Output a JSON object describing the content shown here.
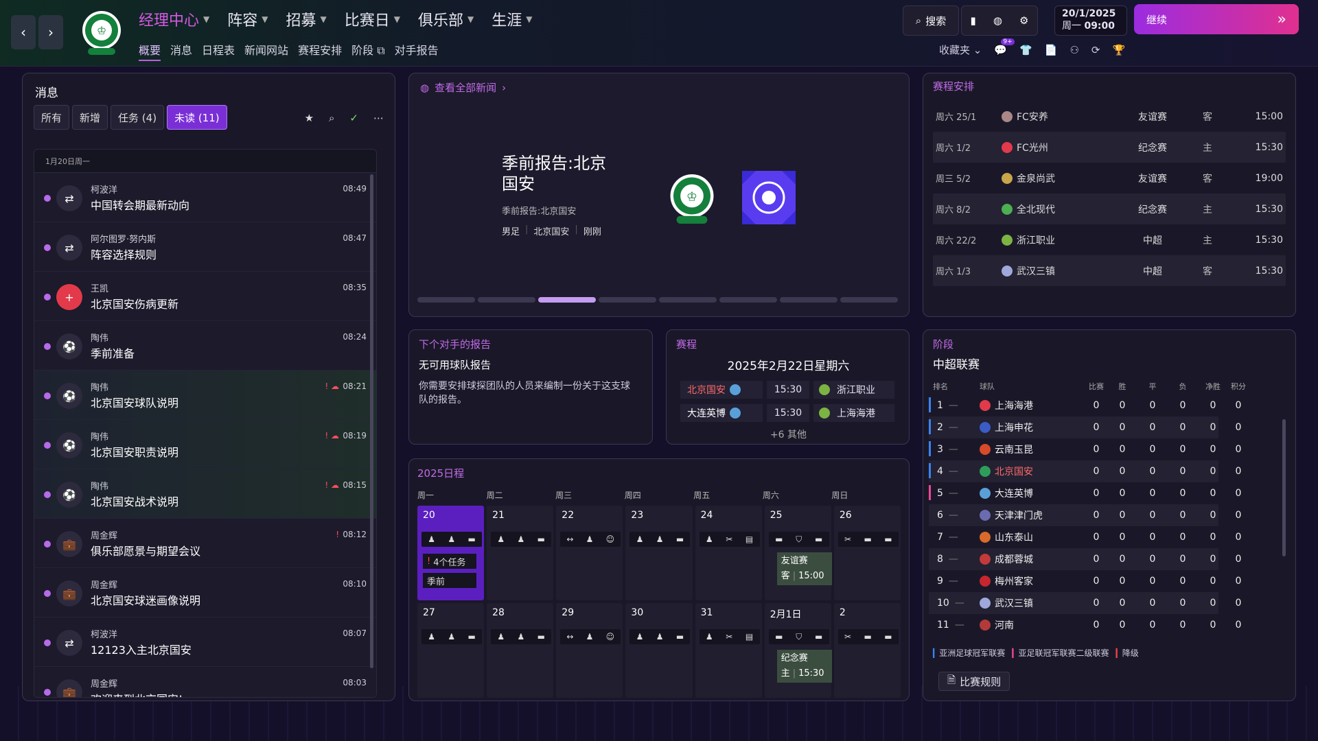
{
  "colors": {
    "accent": "#c25ae6",
    "continue_from": "#9b2ce0",
    "continue_to": "#e0308f",
    "champion_bar": "#3b82f6",
    "acl2_bar": "#ec4899",
    "relegation_bar": "#ef4444"
  },
  "nav": {
    "main": [
      {
        "label": "经理中心",
        "active": true
      },
      {
        "label": "阵容"
      },
      {
        "label": "招募"
      },
      {
        "label": "比赛日"
      },
      {
        "label": "俱乐部"
      },
      {
        "label": "生涯"
      }
    ],
    "sub": [
      "概要",
      "消息",
      "日程表",
      "新闻网站",
      "赛程安排",
      "阶段",
      "对手报告"
    ],
    "search": "搜索",
    "date": "20/1/2025",
    "weekday": "周一",
    "time": "09:00",
    "continue": "继续",
    "favorites": "收藏夹",
    "badge": "9+"
  },
  "messages": {
    "title": "消息",
    "tabs": [
      "所有",
      "新增",
      "任务 (4)",
      "未读 (11)"
    ],
    "date_header": "1月20日周一",
    "items": [
      {
        "from": "柯波洋",
        "subject": "中国转会期最新动向",
        "time": "08:49",
        "icon": "transfer-icon",
        "green": false,
        "flag": false
      },
      {
        "from": "阿尔图罗·努内斯",
        "subject": "阵容选择规则",
        "time": "08:47",
        "icon": "transfer-icon",
        "green": false,
        "flag": false
      },
      {
        "from": "王凯",
        "subject": "北京国安伤病更新",
        "time": "08:35",
        "icon": "medical-icon",
        "green": false,
        "flag": false
      },
      {
        "from": "陶伟",
        "subject": "季前准备",
        "time": "08:24",
        "icon": "team-icon",
        "green": false,
        "flag": false
      },
      {
        "from": "陶伟",
        "subject": "北京国安球队说明",
        "time": "08:21",
        "icon": "team-icon",
        "green": true,
        "flag": true
      },
      {
        "from": "陶伟",
        "subject": "北京国安职责说明",
        "time": "08:19",
        "icon": "team-icon",
        "green": true,
        "flag": true
      },
      {
        "from": "陶伟",
        "subject": "北京国安战术说明",
        "time": "08:15",
        "icon": "team-icon",
        "green": true,
        "flag": true
      },
      {
        "from": "周金辉",
        "subject": "俱乐部愿景与期望会议",
        "time": "08:12",
        "icon": "board-icon",
        "green": false,
        "flag": true
      },
      {
        "from": "周金辉",
        "subject": "北京国安球迷画像说明",
        "time": "08:10",
        "icon": "board-icon",
        "green": false,
        "flag": false
      },
      {
        "from": "柯波洋",
        "subject": "12123入主北京国安",
        "time": "08:07",
        "icon": "transfer-icon",
        "green": false,
        "flag": false
      },
      {
        "from": "周金辉",
        "subject": "欢迎来到北京国安!",
        "time": "08:03",
        "icon": "board-icon",
        "green": false,
        "flag": false
      }
    ]
  },
  "news": {
    "link": "查看全部新闻",
    "headline": "季前报告:北京国安",
    "sub": "季前报告:北京国安",
    "tags": [
      "男足",
      "北京国安",
      "刚刚"
    ],
    "pages": 8,
    "active_page": 3
  },
  "fixtures": {
    "title": "赛程安排",
    "rows": [
      {
        "date": "周六 25/1",
        "team": "FC安养",
        "comp": "友谊赛",
        "venue": "客",
        "time": "15:00",
        "crest": "#a88"
      },
      {
        "date": "周六 1/2",
        "team": "FC光州",
        "comp": "纪念赛",
        "venue": "主",
        "time": "15:30",
        "crest": "#e23a4a"
      },
      {
        "date": "周三 5/2",
        "team": "金泉尚武",
        "comp": "友谊赛",
        "venue": "客",
        "time": "19:00",
        "crest": "#c9a64a"
      },
      {
        "date": "周六 8/2",
        "team": "全北现代",
        "comp": "纪念赛",
        "venue": "主",
        "time": "15:30",
        "crest": "#4caf50"
      },
      {
        "date": "周六 22/2",
        "team": "浙江职业",
        "comp": "中超",
        "venue": "主",
        "time": "15:30",
        "crest": "#7cb342"
      },
      {
        "date": "周六 1/3",
        "team": "武汉三镇",
        "comp": "中超",
        "venue": "客",
        "time": "15:30",
        "crest": "#9fa8da"
      }
    ]
  },
  "opponent": {
    "title": "下个对手的报告",
    "heading": "无可用球队报告",
    "body": "你需要安排球探团队的人员来编制一份关于这支球队的报告。"
  },
  "matches": {
    "title": "赛程",
    "date": "2025年2月22日星期六",
    "rows": [
      {
        "home": "北京国安",
        "time": "15:30",
        "away": "浙江职业",
        "highlight": true
      },
      {
        "home": "大连英博",
        "time": "15:30",
        "away": "上海海港",
        "highlight": false
      }
    ],
    "more": "+6 其他"
  },
  "calendar": {
    "title": "2025日程",
    "days": [
      "周一",
      "周二",
      "周三",
      "周四",
      "周五",
      "周六",
      "周日"
    ],
    "week1": [
      "20",
      "21",
      "22",
      "23",
      "24",
      "25",
      "26"
    ],
    "week2": [
      "27",
      "28",
      "29",
      "30",
      "31",
      "2月1日",
      "2"
    ],
    "tasks": "4个任务",
    "phase": "季前",
    "match1": {
      "comp": "友谊赛",
      "venue": "客",
      "time": "15:00"
    },
    "match2": {
      "comp": "纪念赛",
      "venue": "主",
      "time": "15:30"
    }
  },
  "league": {
    "title": "阶段",
    "name": "中超联赛",
    "headers": [
      "排名",
      "球队",
      "比赛",
      "胜",
      "平",
      "负",
      "净胜",
      "积分"
    ],
    "rows": [
      {
        "pos": "1",
        "team": "上海海港",
        "crest": "#e23a4a",
        "bar": "blue"
      },
      {
        "pos": "2",
        "team": "上海申花",
        "crest": "#3b5cc4",
        "bar": "blue"
      },
      {
        "pos": "3",
        "team": "云南玉昆",
        "crest": "#d84a2a",
        "bar": "blue"
      },
      {
        "pos": "4",
        "team": "北京国安",
        "crest": "#2e9d5a",
        "bar": "blue",
        "self": true
      },
      {
        "pos": "5",
        "team": "大连英博",
        "crest": "#5aa0d8",
        "bar": "pink"
      },
      {
        "pos": "6",
        "team": "天津津门虎",
        "crest": "#6b6bb0",
        "bar": ""
      },
      {
        "pos": "7",
        "team": "山东泰山",
        "crest": "#d96a2a",
        "bar": ""
      },
      {
        "pos": "8",
        "team": "成都蓉城",
        "crest": "#c23a3a",
        "bar": ""
      },
      {
        "pos": "9",
        "team": "梅州客家",
        "crest": "#c8262e",
        "bar": ""
      },
      {
        "pos": "10",
        "team": "武汉三镇",
        "crest": "#9fa8da",
        "bar": ""
      },
      {
        "pos": "11",
        "team": "河南",
        "crest": "#b33a3a",
        "bar": ""
      }
    ],
    "legend": [
      "亚洲足球冠军联赛",
      "亚足联冠军联赛二级联赛",
      "降级"
    ],
    "rules": "比赛规则"
  }
}
